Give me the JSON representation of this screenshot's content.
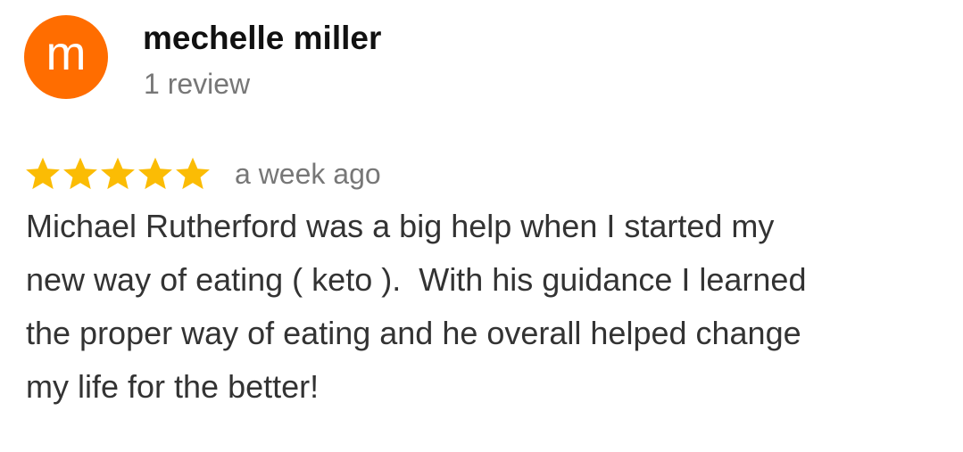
{
  "reviewer": {
    "avatar_letter": "m",
    "avatar_color": "#ff6d00",
    "name": "mechelle miller",
    "review_count": "1 review"
  },
  "review": {
    "rating": 5,
    "rating_max": 5,
    "star_color": "#fbbc04",
    "star_icon": "star-filled-icon",
    "time": "a week ago",
    "text_lines": [
      "Michael Rutherford was a big help when I started my",
      "new way of eating ( keto ).  With his guidance I learned",
      "the proper way of eating and he overall helped change",
      "my life for the better!"
    ]
  }
}
